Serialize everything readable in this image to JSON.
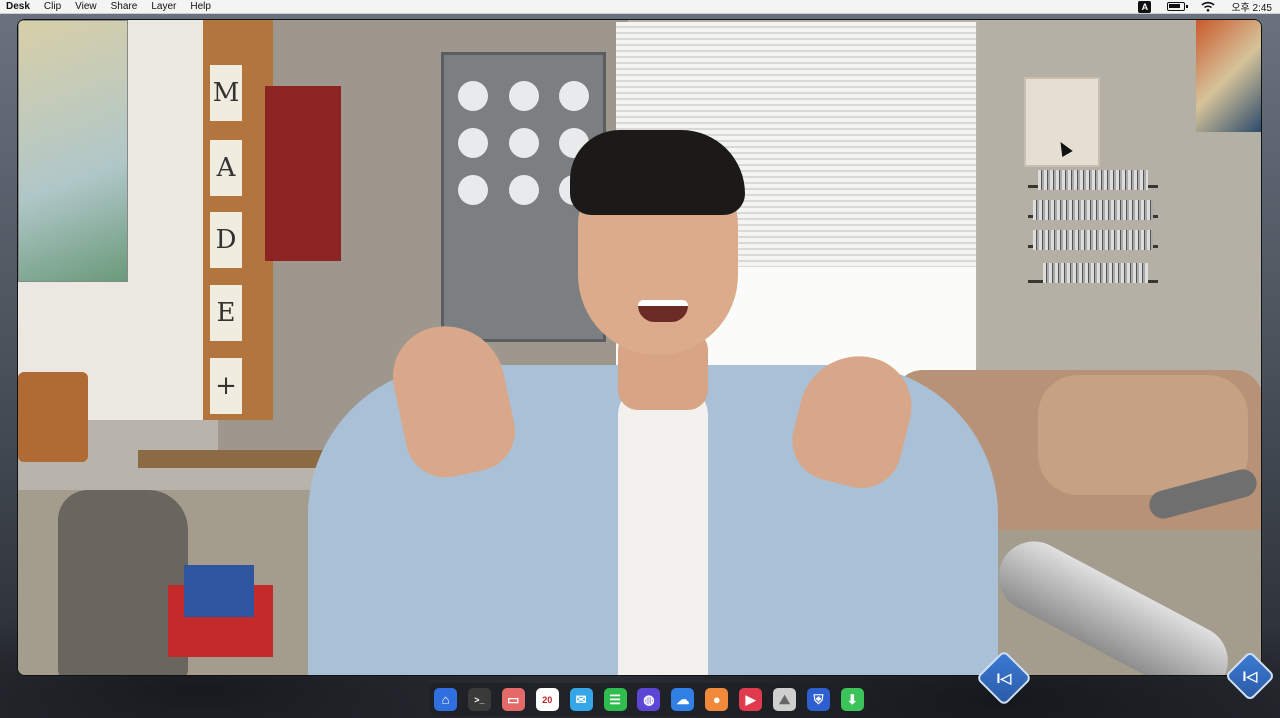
{
  "menubar": {
    "items": [
      "Desk",
      "Clip",
      "View",
      "Share",
      "Layer",
      "Help"
    ],
    "input_method": "A",
    "clock": "오후 2:45"
  },
  "video": {
    "sign_letters": [
      "M",
      "A",
      "D",
      "E",
      "+"
    ]
  },
  "dock": {
    "icons": [
      {
        "name": "home-icon",
        "glyph": "⌂",
        "color": "#2f6fe0"
      },
      {
        "name": "terminal-icon",
        "glyph": ">_",
        "color": "#3a3a3a"
      },
      {
        "name": "card-icon",
        "glyph": "▭",
        "color": "#e46a6a"
      },
      {
        "name": "calendar-icon",
        "glyph": "20",
        "color": "#ffffff"
      },
      {
        "name": "mail-icon",
        "glyph": "✉",
        "color": "#35a7e8"
      },
      {
        "name": "chat-icon",
        "glyph": "💬",
        "color": "#2ebd4e"
      },
      {
        "name": "browser-icon",
        "glyph": "◍",
        "color": "#5b46d6"
      },
      {
        "name": "cloud-icon",
        "glyph": "☁",
        "color": "#2f7fe5"
      },
      {
        "name": "contacts-icon",
        "glyph": "👤",
        "color": "#f08a3a"
      },
      {
        "name": "video-player-icon",
        "glyph": "▶",
        "color": "#e03a4e"
      },
      {
        "name": "photos-icon",
        "glyph": "⛰",
        "color": "#cfcfcf"
      },
      {
        "name": "shield-icon",
        "glyph": "⛨",
        "color": "#2d5fd0"
      },
      {
        "name": "download-icon",
        "glyph": "⬇",
        "color": "#3cc45a"
      }
    ]
  },
  "colors": {
    "accent_logo": "#3a7bd5"
  }
}
